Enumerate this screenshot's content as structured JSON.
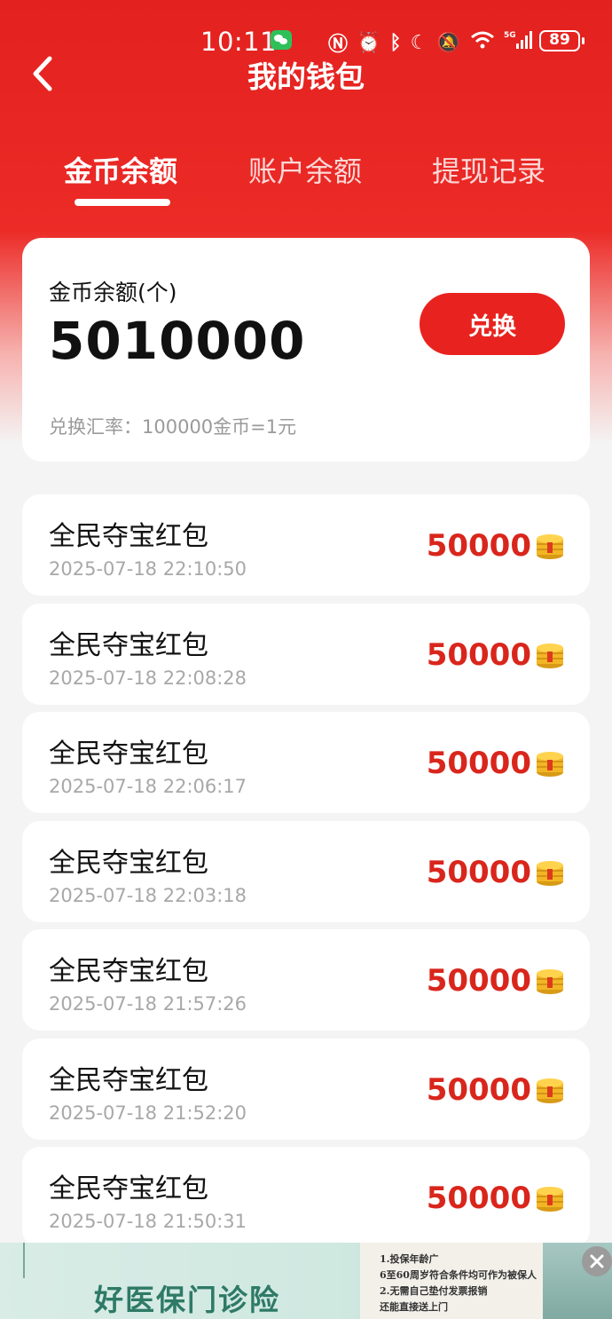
{
  "status_bar": {
    "time": "10:11",
    "battery": "89"
  },
  "nav": {
    "title": "我的钱包"
  },
  "tabs": [
    {
      "label": "金币余额",
      "active": true
    },
    {
      "label": "账户余额",
      "active": false
    },
    {
      "label": "提现记录",
      "active": false
    }
  ],
  "balance": {
    "label": "金币余额(个)",
    "value": "5010000",
    "exchange_label": "兑换",
    "rate": "兑换汇率：100000金币=1元"
  },
  "records": [
    {
      "title": "全民夺宝红包",
      "time": "2025-07-18 22:10:50",
      "amount": "50000"
    },
    {
      "title": "全民夺宝红包",
      "time": "2025-07-18 22:08:28",
      "amount": "50000"
    },
    {
      "title": "全民夺宝红包",
      "time": "2025-07-18 22:06:17",
      "amount": "50000"
    },
    {
      "title": "全民夺宝红包",
      "time": "2025-07-18 22:03:18",
      "amount": "50000"
    },
    {
      "title": "全民夺宝红包",
      "time": "2025-07-18 21:57:26",
      "amount": "50000"
    },
    {
      "title": "全民夺宝红包",
      "time": "2025-07-18 21:52:20",
      "amount": "50000"
    },
    {
      "title": "全民夺宝红包",
      "time": "2025-07-18 21:50:31",
      "amount": "50000"
    }
  ],
  "ad": {
    "title": "好医保门诊险",
    "lines": [
      "1.投保年龄广",
      "6至60周岁符合条件均可作为被保人",
      "2.无需自己垫付发票报销",
      "还能直接送上门"
    ]
  },
  "colors": {
    "brand_red": "#e8231f",
    "amount_red": "#d9261c"
  },
  "icons": [
    "back-icon",
    "coin-icon",
    "close-icon",
    "wechat-icon",
    "battery-icon"
  ]
}
